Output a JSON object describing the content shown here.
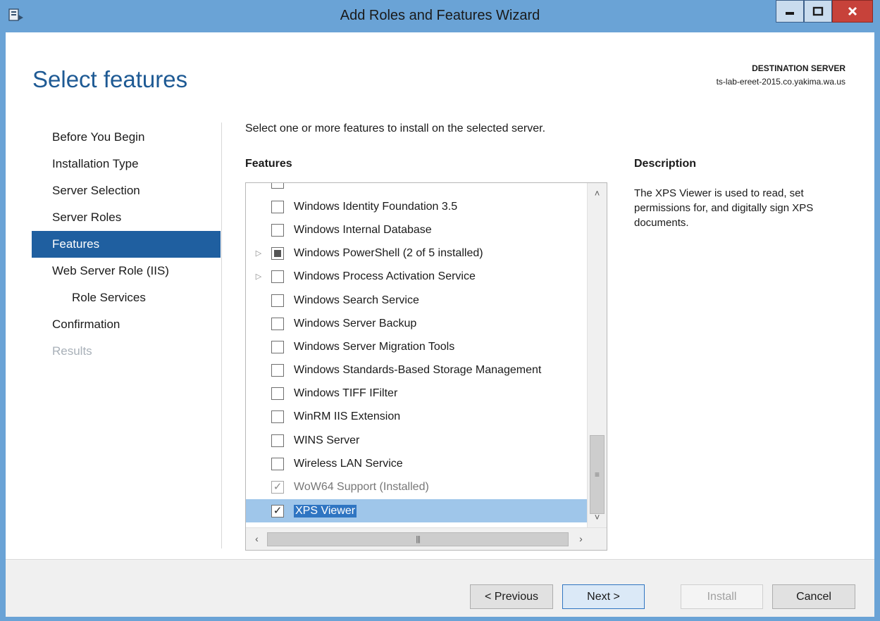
{
  "window": {
    "title": "Add Roles and Features Wizard",
    "icon": "server-manager-icon",
    "controls": {
      "minimize": "minimize-icon",
      "maximize": "maximize-icon",
      "close": "close-icon"
    }
  },
  "header": {
    "page_title": "Select features",
    "destination_label": "DESTINATION SERVER",
    "destination_server": "ts-lab-ereet-2015.co.yakima.wa.us"
  },
  "nav": {
    "items": [
      {
        "label": "Before You Begin",
        "state": "normal"
      },
      {
        "label": "Installation Type",
        "state": "normal"
      },
      {
        "label": "Server Selection",
        "state": "normal"
      },
      {
        "label": "Server Roles",
        "state": "normal"
      },
      {
        "label": "Features",
        "state": "active"
      },
      {
        "label": "Web Server Role (IIS)",
        "state": "normal"
      },
      {
        "label": "Role Services",
        "state": "sub"
      },
      {
        "label": "Confirmation",
        "state": "normal"
      },
      {
        "label": "Results",
        "state": "disabled"
      }
    ]
  },
  "main": {
    "instruction": "Select one or more features to install on the selected server.",
    "features_header": "Features",
    "features": [
      {
        "label": "Windows Identity Foundation 3.5",
        "checked": false,
        "expandable": false
      },
      {
        "label": "Windows Internal Database",
        "checked": false,
        "expandable": false
      },
      {
        "label": "Windows PowerShell (2 of 5 installed)",
        "checked": "partial",
        "expandable": true
      },
      {
        "label": "Windows Process Activation Service",
        "checked": false,
        "expandable": true
      },
      {
        "label": "Windows Search Service",
        "checked": false,
        "expandable": false
      },
      {
        "label": "Windows Server Backup",
        "checked": false,
        "expandable": false
      },
      {
        "label": "Windows Server Migration Tools",
        "checked": false,
        "expandable": false
      },
      {
        "label": "Windows Standards-Based Storage Management",
        "checked": false,
        "expandable": false
      },
      {
        "label": "Windows TIFF IFilter",
        "checked": false,
        "expandable": false
      },
      {
        "label": "WinRM IIS Extension",
        "checked": false,
        "expandable": false
      },
      {
        "label": "WINS Server",
        "checked": false,
        "expandable": false
      },
      {
        "label": "Wireless LAN Service",
        "checked": false,
        "expandable": false
      },
      {
        "label": "WoW64 Support (Installed)",
        "checked": "installed",
        "expandable": false
      },
      {
        "label": "XPS Viewer",
        "checked": true,
        "expandable": false,
        "selected": true
      }
    ],
    "description_header": "Description",
    "description_text": "The XPS Viewer is used to read, set permissions for, and digitally sign XPS documents."
  },
  "footer": {
    "previous_label": "< Previous",
    "next_label": "Next >",
    "install_label": "Install",
    "cancel_label": "Cancel"
  },
  "colors": {
    "title_bar": "#6aa3d6",
    "page_title": "#1e5a94",
    "nav_active": "#1f5fa0",
    "selection": "#2f75c2",
    "close_button": "#c7423a"
  }
}
